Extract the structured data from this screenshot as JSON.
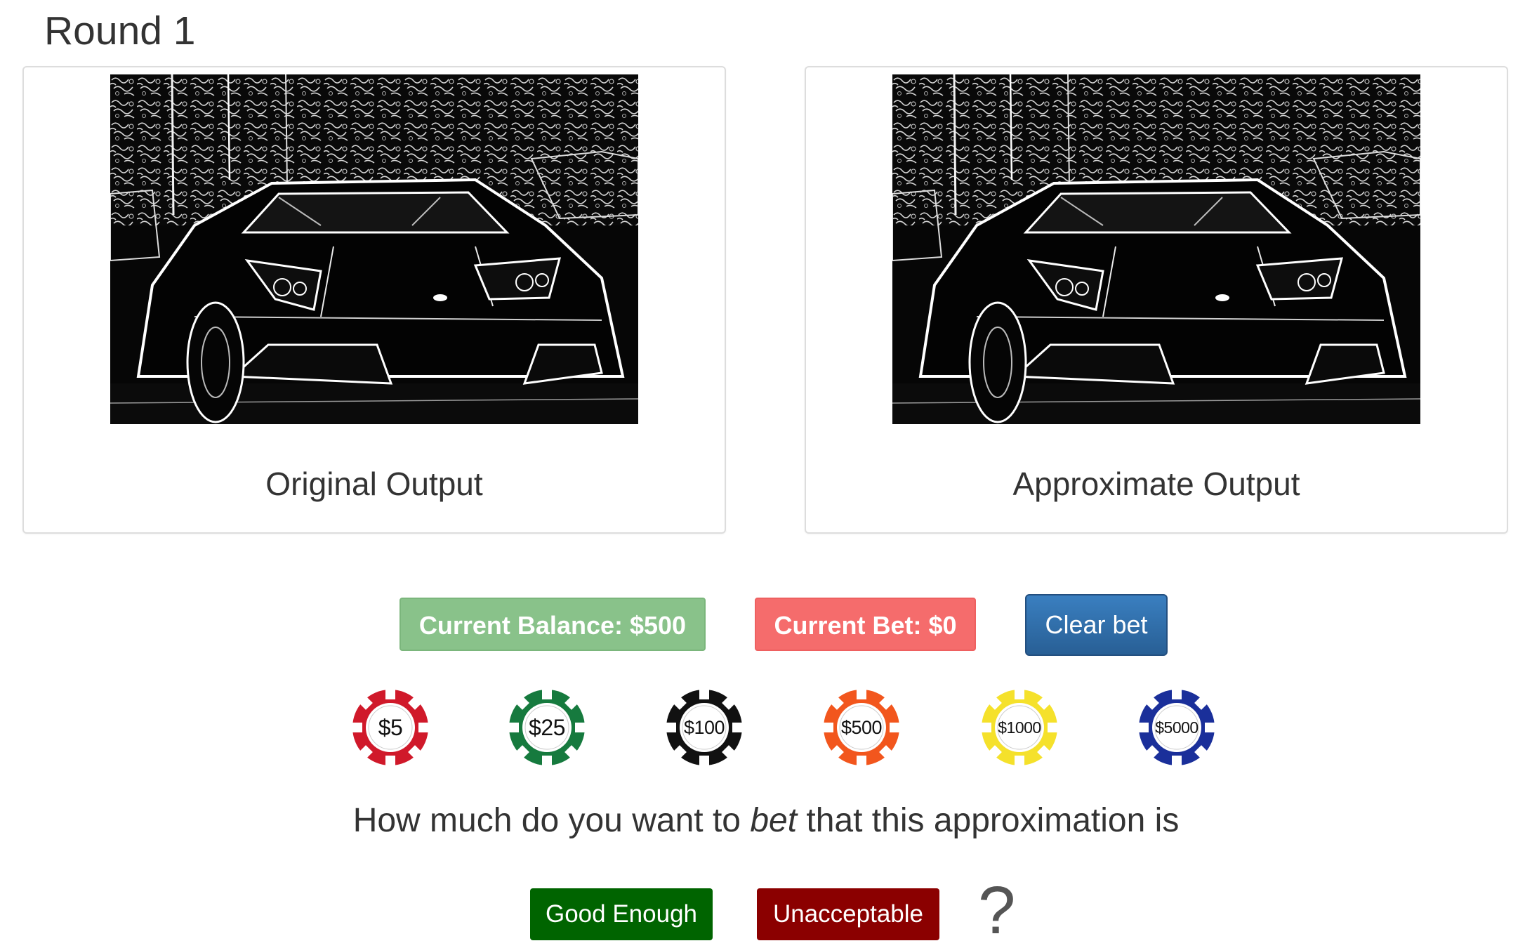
{
  "round": {
    "title": "Round 1"
  },
  "panels": [
    {
      "caption": "Original Output",
      "image": "edge-detected-car-image"
    },
    {
      "caption": "Approximate Output",
      "image": "edge-detected-car-image"
    }
  ],
  "status": {
    "balance_label": "Current Balance: $500",
    "bet_label": "Current Bet: $0",
    "clear_label": "Clear bet"
  },
  "chips": [
    {
      "label": "$5",
      "color": "#d0192a"
    },
    {
      "label": "$25",
      "color": "#167a3e"
    },
    {
      "label": "$100",
      "color": "#111111"
    },
    {
      "label": "$500",
      "color": "#f2561d"
    },
    {
      "label": "$1000",
      "color": "#f5e12b"
    },
    {
      "label": "$5000",
      "color": "#1a2f9a"
    }
  ],
  "question": {
    "before": "How much do you want to ",
    "emphasis": "bet",
    "after": " that this approximation is"
  },
  "answers": {
    "good_label": "Good Enough",
    "bad_label": "Unacceptable",
    "qmark": "?"
  },
  "colors": {
    "balance": "#89c28a",
    "bet": "#f56c6c",
    "clear": "#2e6da4",
    "good": "#006400",
    "bad": "#8b0000"
  }
}
